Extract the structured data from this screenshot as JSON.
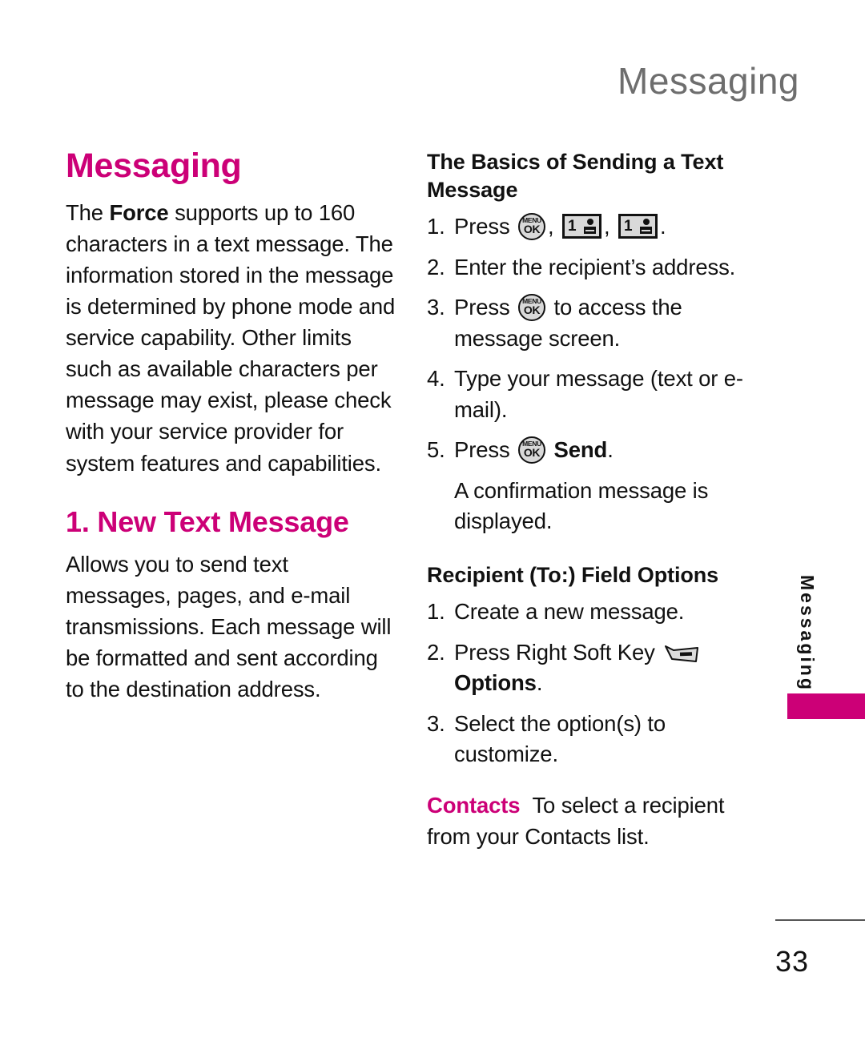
{
  "colors": {
    "accent_magenta": "#CC0077",
    "header_gray": "#6E6E6E",
    "body_black": "#111111",
    "key_fill": "#D9D9D9"
  },
  "running_header": {
    "title": "Messaging"
  },
  "left_column": {
    "section_title": "Messaging",
    "intro_paragraph": {
      "before": "The ",
      "bold": "Force",
      "after": " supports up to 160 characters in a text message. The information stored in the message is determined by phone mode and service capability. Other limits such as available characters per message may exist, please check with your service provider for system features and capabilities."
    },
    "sub_title": "1. New Text Message",
    "sub_paragraph": "Allows you to send text messages, pages, and e-mail transmissions. Each message will be formatted and sent according to the destination address."
  },
  "right_column": {
    "basics_heading": "The Basics of Sending a Text Message",
    "basics_steps": [
      {
        "num": "1.",
        "parts": [
          "Press ",
          "[MENU/OK icon]",
          " , ",
          "[key-1 icon]",
          " , ",
          "[key-1 icon]",
          " ."
        ],
        "text_before_icon": "Press",
        "comma": ",",
        "period": "."
      },
      {
        "num": "2.",
        "text": "Enter the recipient’s address."
      },
      {
        "num": "3.",
        "text_before": "Press",
        "text_after": "to access the message screen."
      },
      {
        "num": "4.",
        "text": "Type your message (text or e-mail)."
      },
      {
        "num": "5.",
        "text_before": "Press",
        "bold_after": "Send",
        "period": "."
      }
    ],
    "basics_note": "A confirmation message is displayed.",
    "recipient_heading": "Recipient (To:) Field Options",
    "recipient_steps": [
      {
        "num": "1.",
        "text": "Create a new message."
      },
      {
        "num": "2.",
        "text_before": "Press Right Soft Key",
        "bold_after": "Options",
        "period": "."
      },
      {
        "num": "3.",
        "text": "Select the option(s) to customize."
      }
    ],
    "definition": {
      "term": "Contacts",
      "description": "To select a recipient from your Contacts list."
    }
  },
  "side_tab": {
    "label": "Messaging"
  },
  "footer": {
    "page_number": "33"
  },
  "icons": {
    "menu_ok": {
      "line1": "MENU",
      "line2": "OK",
      "name": "menu-ok-key-icon"
    },
    "key_one_voicemail": {
      "digit": "1",
      "name": "key-1-voicemail-icon"
    },
    "right_soft_key": {
      "name": "right-soft-key-icon"
    }
  }
}
